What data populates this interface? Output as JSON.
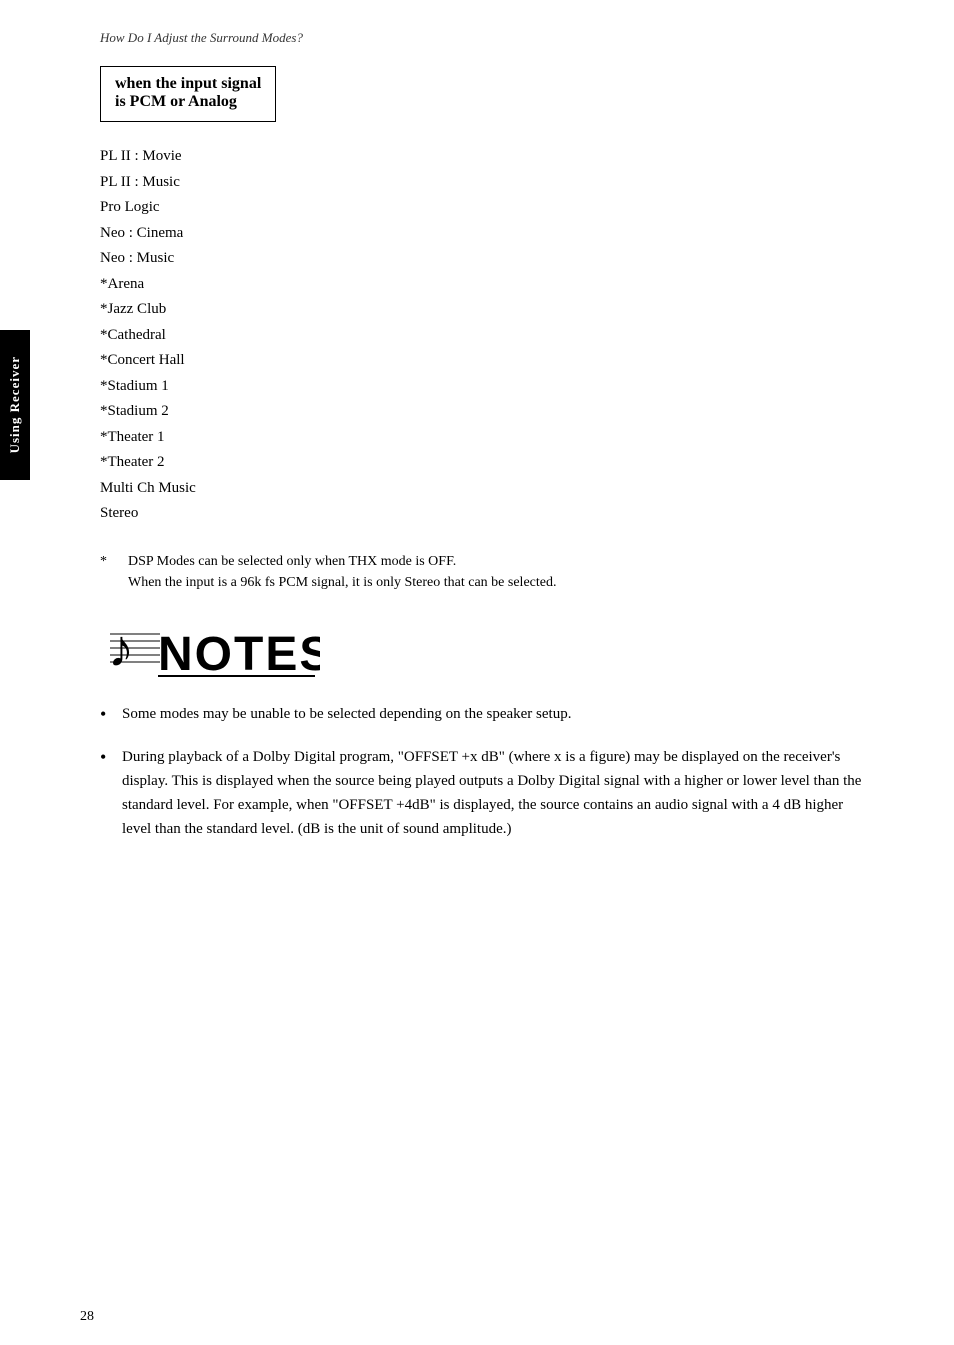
{
  "header": {
    "text": "How Do I Adjust the Surround Modes?"
  },
  "section_title": {
    "line1": "when the input signal",
    "line2": "is PCM or Analog"
  },
  "modes": [
    {
      "label": "PL II : Movie"
    },
    {
      "label": "PL II : Music"
    },
    {
      "label": "Pro Logic"
    },
    {
      "label": "Neo : Cinema"
    },
    {
      "label": "Neo : Music"
    },
    {
      "label": "*Arena"
    },
    {
      "label": "*Jazz Club"
    },
    {
      "label": "*Cathedral"
    },
    {
      "label": "*Concert Hall"
    },
    {
      "label": "*Stadium 1"
    },
    {
      "label": "*Stadium 2"
    },
    {
      "label": "*Theater 1"
    },
    {
      "label": "*Theater 2"
    },
    {
      "label": "Multi Ch Music"
    },
    {
      "label": "Stereo"
    }
  ],
  "footnote": {
    "star": "*",
    "line1": "DSP Modes can be selected only when THX mode is OFF.",
    "line2": "When the input is a 96k fs PCM signal, it is only Stereo that can be selected."
  },
  "notes_label": "NOTES",
  "bullets": [
    {
      "text": "Some modes may be unable to be selected depending on the speaker setup."
    },
    {
      "text": "During playback of a Dolby Digital program, \"OFFSET +x dB\" (where x is a figure) may be displayed on the receiver's display. This is displayed when the source being played outputs a Dolby Digital signal with a higher or lower level than the standard level. For example, when \"OFFSET +4dB\" is displayed, the source contains an audio signal with a 4 dB higher level than the standard level. (dB is the unit of sound amplitude.)"
    }
  ],
  "sidebar_label": "Using Receiver",
  "page_number": "28"
}
